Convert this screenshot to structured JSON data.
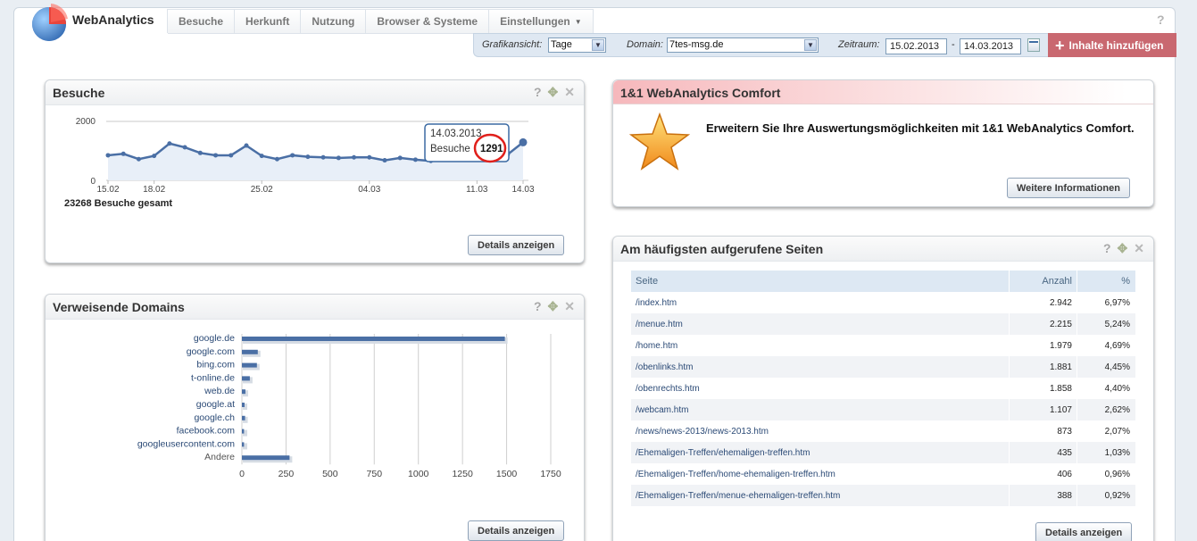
{
  "app": {
    "name": "WebAnalytics"
  },
  "nav": {
    "tabs": [
      "Besuche",
      "Herkunft",
      "Nutzung",
      "Browser & Systeme",
      "Einstellungen"
    ]
  },
  "help_top": "?",
  "filters": {
    "grafik_label": "Grafikansicht:",
    "grafik_value": "Tage",
    "domain_label": "Domain:",
    "domain_value": "7tes-msg.de",
    "zeitraum_label": "Zeitraum:",
    "date_from": "15.02.2013",
    "date_sep": "-",
    "date_to": "14.03.2013"
  },
  "add_button": {
    "label": "Inhalte hinzufügen"
  },
  "panel_icons": {
    "help": "?",
    "move": "✥",
    "close": "✕"
  },
  "besuche": {
    "title": "Besuche",
    "total": "23268 Besuche gesamt",
    "details_label": "Details anzeigen",
    "tooltip": {
      "date": "14.03.2013",
      "label": "Besuche",
      "value": "1291"
    }
  },
  "promo": {
    "title": "1&1 WebAnalytics Comfort",
    "text": "Erweitern Sie Ihre Auswertungsmöglichkeiten mit 1&1 WebAnalytics Comfort.",
    "button": "Weitere Informationen"
  },
  "domains": {
    "title": "Verweisende Domains",
    "details_label": "Details anzeigen"
  },
  "top_pages": {
    "title": "Am häufigsten aufgerufene Seiten",
    "columns": [
      "Seite",
      "Anzahl",
      "%"
    ],
    "rows": [
      [
        "/index.htm",
        "2.942",
        "6,97%"
      ],
      [
        "/menue.htm",
        "2.215",
        "5,24%"
      ],
      [
        "/home.htm",
        "1.979",
        "4,69%"
      ],
      [
        "/obenlinks.htm",
        "1.881",
        "4,45%"
      ],
      [
        "/obenrechts.htm",
        "1.858",
        "4,40%"
      ],
      [
        "/webcam.htm",
        "1.107",
        "2,62%"
      ],
      [
        "/news/news-2013/news-2013.htm",
        "873",
        "2,07%"
      ],
      [
        "/Ehemaligen-Treffen/ehemaligen-treffen.htm",
        "435",
        "1,03%"
      ],
      [
        "/Ehemaligen-Treffen/home-ehemaligen-treffen.htm",
        "406",
        "0,96%"
      ],
      [
        "/Ehemaligen-Treffen/menue-ehemaligen-treffen.htm",
        "388",
        "0,92%"
      ]
    ],
    "details_label": "Details anzeigen"
  },
  "colors": {
    "accent": "#4a6fa5",
    "add_button": "#c96870",
    "highlight_circle": "#e0201b"
  },
  "chart_data": [
    {
      "type": "line",
      "title": "",
      "x": [
        "15.02",
        "16.02",
        "17.02",
        "18.02",
        "19.02",
        "20.02",
        "21.02",
        "22.02",
        "23.02",
        "24.02",
        "25.02",
        "26.02",
        "27.02",
        "28.02",
        "01.03",
        "02.03",
        "03.03",
        "04.03",
        "05.03",
        "06.03",
        "07.03",
        "08.03",
        "09.03",
        "10.03",
        "11.03",
        "12.03",
        "13.03",
        "14.03"
      ],
      "x_ticks": [
        "15.02",
        "18.02",
        "25.02",
        "04.03",
        "11.03",
        "14.03"
      ],
      "y_ticks": [
        "2000",
        "0"
      ],
      "ylim": [
        0,
        2000
      ],
      "series": [
        {
          "values": [
            850,
            900,
            720,
            830,
            1250,
            1120,
            930,
            850,
            850,
            1180,
            830,
            720,
            850,
            800,
            780,
            760,
            780,
            780,
            680,
            760,
            700,
            660,
            720,
            740,
            760,
            780,
            880,
            1291
          ]
        }
      ]
    },
    {
      "type": "bar",
      "orientation": "horizontal",
      "categories": [
        "google.de",
        "google.com",
        "bing.com",
        "t-online.de",
        "web.de",
        "google.at",
        "google.ch",
        "facebook.com",
        "googleusercontent.com",
        "Andere"
      ],
      "values": [
        1490,
        90,
        85,
        45,
        20,
        15,
        18,
        12,
        12,
        270
      ],
      "x_ticks": [
        "0",
        "250",
        "500",
        "750",
        "1000",
        "1250",
        "1500",
        "1750"
      ],
      "xlim": [
        0,
        1750
      ]
    }
  ]
}
